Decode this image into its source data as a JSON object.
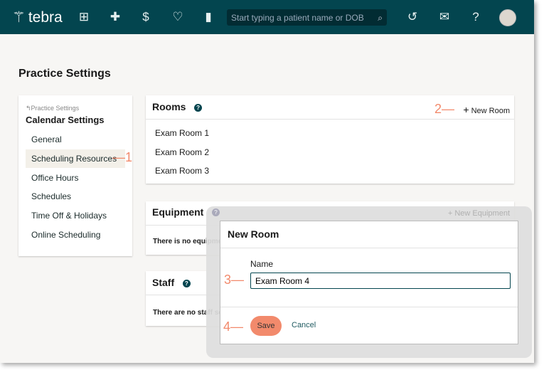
{
  "header": {
    "brand": "tebra",
    "search_placeholder": "Start typing a patient name or DOB",
    "nav_icons": [
      "apps-grid-icon",
      "clinical-cross-icon",
      "billing-dollar-icon",
      "patient-engagement-icon",
      "reports-bar-chart-icon"
    ],
    "right_icons": [
      "history-icon",
      "mail-icon",
      "help-icon"
    ],
    "color": "#03454f"
  },
  "page": {
    "title": "Practice Settings"
  },
  "sidebar": {
    "back_link": "Practice Settings",
    "section": "Calendar Settings",
    "items": [
      {
        "label": "General"
      },
      {
        "label": "Scheduling Resources",
        "active": true
      },
      {
        "label": "Office Hours"
      },
      {
        "label": "Schedules"
      },
      {
        "label": "Time Off & Holidays"
      },
      {
        "label": "Online Scheduling"
      }
    ]
  },
  "rooms": {
    "title": "Rooms",
    "new_label": "New Room",
    "items": [
      "Exam Room 1",
      "Exam Room 2",
      "Exam Room 3"
    ]
  },
  "equipment": {
    "title": "Equipment",
    "new_label": "New Equipment",
    "empty": "There is no equipment set up"
  },
  "staff": {
    "title": "Staff",
    "empty": "There are no staff set up"
  },
  "modal": {
    "title": "New Room",
    "name_label": "Name",
    "name_value": "Exam Room 4",
    "save_label": "Save",
    "cancel_label": "Cancel"
  },
  "callouts": [
    "1",
    "2",
    "3",
    "4"
  ],
  "accent": "#f28a6c"
}
